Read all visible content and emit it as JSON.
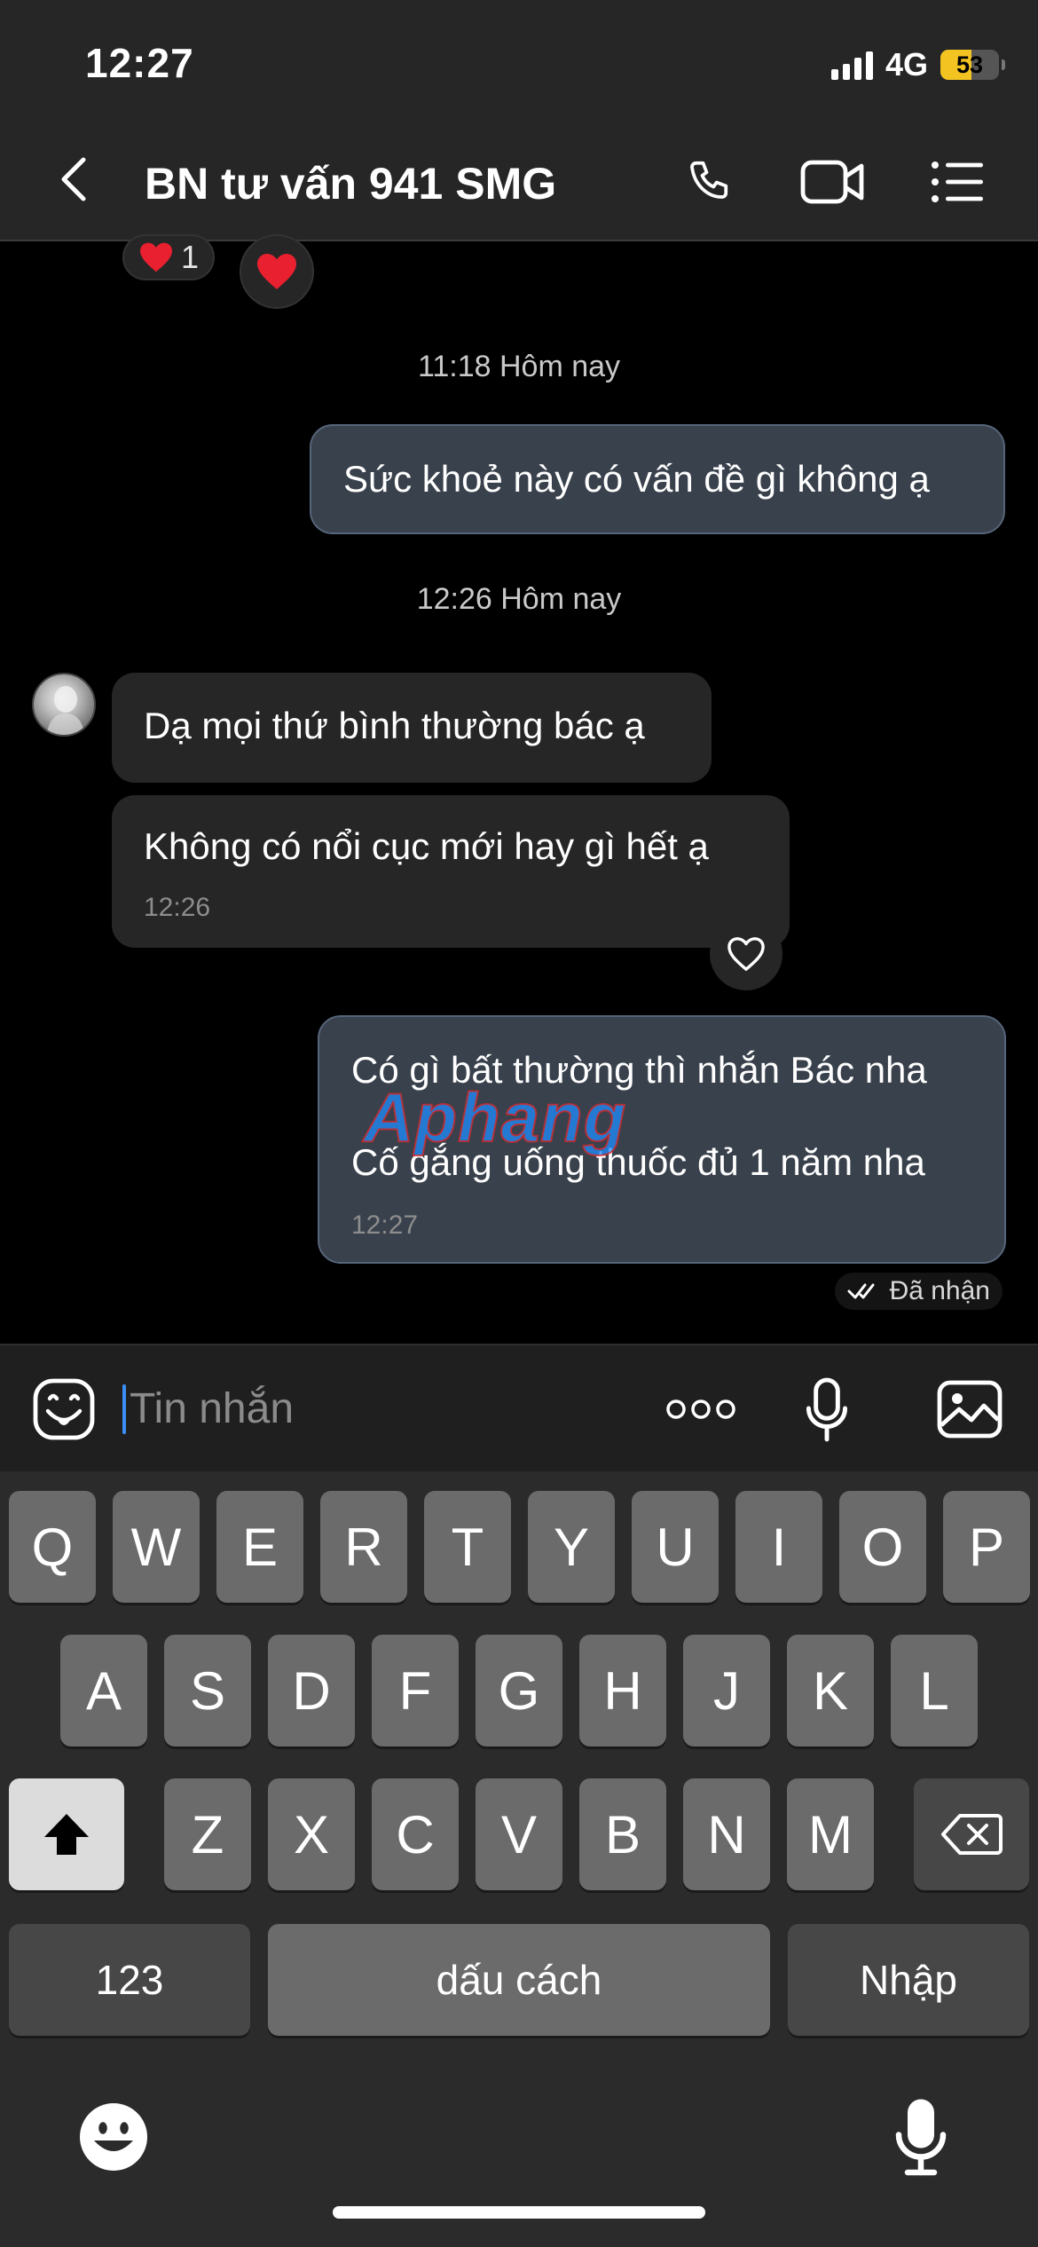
{
  "status_bar": {
    "time": "12:27",
    "network": "4G",
    "battery": "53",
    "battery_fraction": 0.53
  },
  "header": {
    "title": "BN tư vấn 941 SMG",
    "back_icon": "chevron-left-icon",
    "call_icon": "phone-icon",
    "video_icon": "video-camera-icon",
    "menu_icon": "list-menu-icon"
  },
  "chat": {
    "top_reactions": {
      "count": "1"
    },
    "messages": [
      {
        "type": "timestamp",
        "text": "11:18 Hôm nay"
      },
      {
        "type": "outgoing",
        "text": "Sức khoẻ này có vấn đề gì không ạ"
      },
      {
        "type": "timestamp",
        "text": "12:26 Hôm nay"
      },
      {
        "type": "incoming",
        "text": "Dạ mọi thứ bình thường bác ạ"
      },
      {
        "type": "incoming",
        "text": "Không có nổi cục mới hay gì hết ạ",
        "time": "12:26"
      },
      {
        "type": "outgoing",
        "lines": [
          "Có gì bất thường thì nhắn Bác nha",
          "Cố gắng uống thuốc đủ 1 năm nha"
        ],
        "time": "12:27"
      }
    ],
    "read_receipt": "Đã nhận",
    "watermark": "Aphang"
  },
  "input_bar": {
    "placeholder": "Tin nhắn",
    "icons": [
      "sticker-icon",
      "more-icon",
      "microphone-icon",
      "image-icon"
    ]
  },
  "keyboard": {
    "row1": [
      "Q",
      "W",
      "E",
      "R",
      "T",
      "Y",
      "U",
      "I",
      "O",
      "P"
    ],
    "row2": [
      "A",
      "S",
      "D",
      "F",
      "G",
      "H",
      "J",
      "K",
      "L"
    ],
    "row3": [
      "Z",
      "X",
      "C",
      "V",
      "B",
      "N",
      "M"
    ],
    "numbers_key": "123",
    "space_key": "dấu cách",
    "return_key": "Nhập"
  },
  "colors": {
    "header_bg": "#262626",
    "outgoing_bubble": "#39414c",
    "incoming_bubble": "#262626",
    "caret": "#3a8ef6",
    "battery": "#f3c322"
  }
}
